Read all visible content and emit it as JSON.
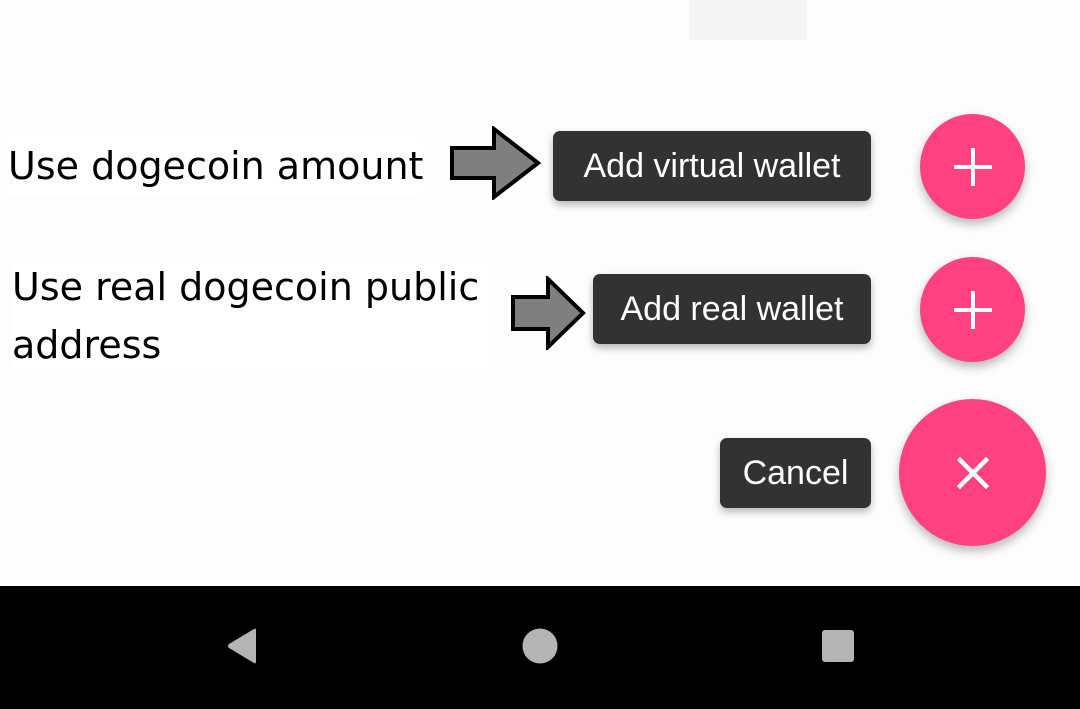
{
  "annotations": {
    "virtual_note": "Use dogecoin amount",
    "real_note_line1": "Use real dogecoin public",
    "real_note_line2": "address"
  },
  "speed_dial": {
    "add_virtual_wallet_label": "Add virtual wallet",
    "add_real_wallet_label": "Add real wallet",
    "cancel_label": "Cancel",
    "mini_fab_icon": "plus-icon",
    "main_fab_icon": "close-icon"
  },
  "colors": {
    "accent": "#ff4081",
    "label_background": "#323232",
    "label_text": "#ffffff",
    "navbar": "#000000",
    "nav_icon": "#b4b4b4",
    "annotation_arrow_fill": "#7f7f7f"
  },
  "navigation_bar": {
    "back_icon": "back-triangle-icon",
    "home_icon": "home-circle-icon",
    "recents_icon": "recents-square-icon"
  }
}
